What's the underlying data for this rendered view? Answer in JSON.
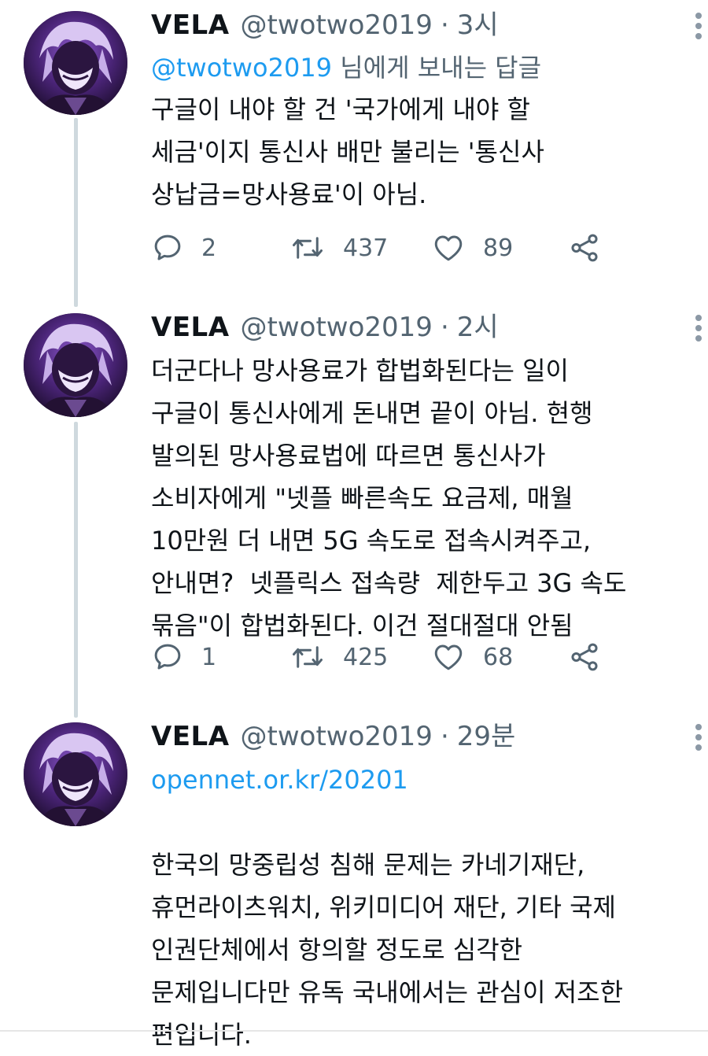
{
  "tweets": [
    {
      "author_name": "VELA",
      "handle": "@twotwo2019",
      "separator": "·",
      "time": "3시",
      "reply_prefix": "@twotwo2019",
      "reply_suffix": " 님에게 보내는 답글",
      "text": "구글이 내야 할 건 '국가에게 내야 할\n세금'이지 통신사 배만 불리는 '통신사\n상납금=망사용료'이 아님.",
      "replies": "2",
      "retweets": "437",
      "likes": "89"
    },
    {
      "author_name": "VELA",
      "handle": "@twotwo2019",
      "separator": "·",
      "time": "2시",
      "text": "더군다나 망사용료가 합법화된다는 일이\n구글이 통신사에게 돈내면 끝이 아님. 현행\n발의된 망사용료법에 따르면 통신사가\n소비자에게 \"넷플 빠른속도 요금제, 매월\n10만원 더 내면 5G 속도로 접속시켜주고,\n안내면?  넷플릭스 접속량  제한두고 3G 속도\n묶음\"이 합법화된다. 이건 절대절대 안됨",
      "replies": "1",
      "retweets": "425",
      "likes": "68"
    },
    {
      "author_name": "VELA",
      "handle": "@twotwo2019",
      "separator": "·",
      "time": "29분",
      "link": "opennet.or.kr/20201",
      "text": "한국의 망중립성 침해 문제는 카네기재단,\n휴먼라이츠워치, 위키미디어 재단, 기타 국제\n인권단체에서 항의할 정도로 심각한\n문제입니다만 유독 국내에서는 관심이 저조한\n편입니다."
    }
  ],
  "icons": {
    "reply": "speech-bubble-icon",
    "retweet": "retweet-arrows-icon",
    "like": "heart-icon",
    "share": "share-nodes-icon",
    "more": "vertical-dots-icon"
  },
  "colors": {
    "text": "#0f1419",
    "secondary": "#536471",
    "link": "#1d9bf0",
    "thread_line": "#cfd9de"
  }
}
